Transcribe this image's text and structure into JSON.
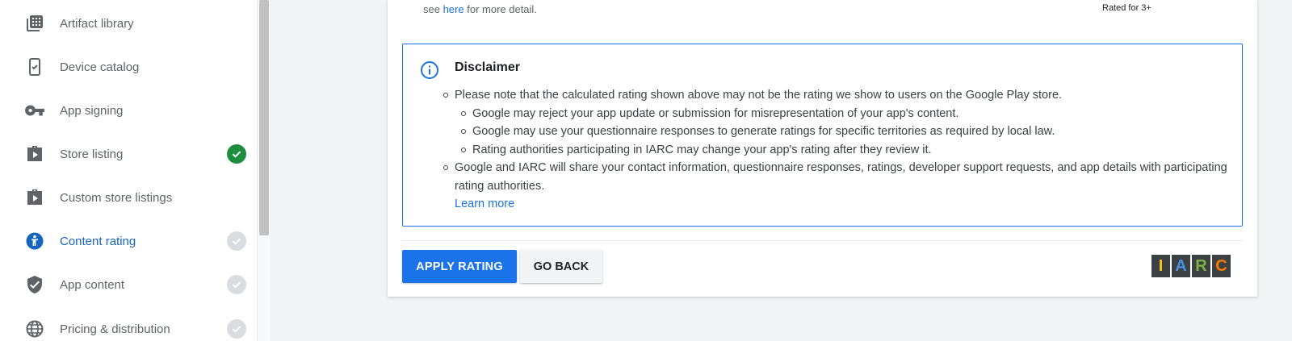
{
  "sidebar": {
    "items": [
      {
        "label": "Artifact library",
        "icon": "grid-icon",
        "status": "none"
      },
      {
        "label": "Device catalog",
        "icon": "phone-check-icon",
        "status": "none"
      },
      {
        "label": "App signing",
        "icon": "key-icon",
        "status": "none"
      },
      {
        "label": "Store listing",
        "icon": "play-store-icon",
        "status": "done"
      },
      {
        "label": "Custom store listings",
        "icon": "play-store-icon",
        "status": "none"
      },
      {
        "label": "Content rating",
        "icon": "content-rating-icon",
        "status": "pending",
        "active": true
      },
      {
        "label": "App content",
        "icon": "shield-icon",
        "status": "pending"
      },
      {
        "label": "Pricing & distribution",
        "icon": "globe-icon",
        "status": "pending"
      }
    ]
  },
  "main": {
    "top_note": {
      "prefix": "see ",
      "link": "here",
      "suffix": " for more detail."
    },
    "rated_for": "Rated for 3+",
    "disclaimer": {
      "title": "Disclaimer",
      "point1": "Please note that the calculated rating shown above may not be the rating we show to users on the Google Play store.",
      "sub1": "Google may reject your app update or submission for misrepresentation of your app's content.",
      "sub2": "Google may use your questionnaire responses to generate ratings for specific territories as required by local law.",
      "sub3": "Rating authorities participating in IARC may change your app's rating after they review it.",
      "point2": "Google and IARC will share your contact information, questionnaire responses, ratings, developer support requests, and app details with participating rating authorities.",
      "learn_more": "Learn more"
    },
    "apply_label": "APPLY RATING",
    "back_label": "GO BACK",
    "iarc_logo": {
      "letters": [
        "I",
        "A",
        "R",
        "C"
      ],
      "colors": [
        "#f9c21a",
        "#4a90e2",
        "#7cb342",
        "#f57c00"
      ]
    }
  },
  "colors": {
    "accent": "#1a73e8",
    "done": "#1e8e3e",
    "pending": "#dadce0"
  }
}
